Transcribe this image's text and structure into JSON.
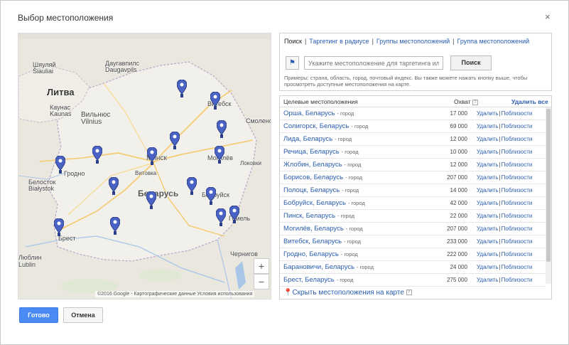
{
  "dialog": {
    "title": "Выбор местоположения",
    "close": "×"
  },
  "map": {
    "labels": {
      "litva": "Литва",
      "belarus": "Беларусь",
      "minsk": "Минск",
      "vitebsk": "Витебск",
      "mogilev": "Могилёв",
      "gomel": "Гомель",
      "grodno": "Гродно",
      "brest": "Брест",
      "bobruysk": "Бобруйск",
      "kaunas": "Каунас\nKaunas",
      "vilnius": "Вильнюс\nVilnius",
      "siauliai": "Шяуляй\nŠiauliai",
      "daugavpils": "Даугавпилс\nDaugavpils",
      "smolensk": "Смоленс",
      "bialystok": "Белосток\nBiałystok",
      "lublin": "Люблин\nLublin",
      "chernigov": "Чернигов",
      "lokovo": "Локовки",
      "vitovka": "Витовка"
    },
    "zoom_in": "+",
    "zoom_out": "−",
    "footer": "©2016 Google - Картографические данные   Условия использования"
  },
  "search": {
    "tabs": [
      "Поиск",
      "Таргетинг в радиусе",
      "Группы местоположений",
      "Группа местоположений"
    ],
    "placeholder": "Укажите местоположение для таргетинга ил",
    "button": "Поиск",
    "hint": "Примеры: страна, область, город, почтовый индекс. Вы также можете нажать кнопку выше, чтобы просмотреть доступные местоположения на карте."
  },
  "results": {
    "col_location": "Целевые местоположения",
    "col_reach": "Охват",
    "remove_all": "Удалить все",
    "remove": "Удалить",
    "nearby": "Поблизости",
    "rows": [
      {
        "name": "Орша, Беларусь",
        "type": "- город",
        "reach": "17 000"
      },
      {
        "name": "Солигорск, Беларусь",
        "type": "- город",
        "reach": "69 000"
      },
      {
        "name": "Лида, Беларусь",
        "type": "- город",
        "reach": "12 000"
      },
      {
        "name": "Речица, Беларусь",
        "type": "- город",
        "reach": "10 000"
      },
      {
        "name": "Жлобин, Беларусь",
        "type": "- город",
        "reach": "12 000"
      },
      {
        "name": "Борисов, Беларусь",
        "type": "- город",
        "reach": "207 000"
      },
      {
        "name": "Полоцк, Беларусь",
        "type": "- город",
        "reach": "14 000"
      },
      {
        "name": "Бобруйск, Беларусь",
        "type": "- город",
        "reach": "42 000"
      },
      {
        "name": "Пинск, Беларусь",
        "type": "- город",
        "reach": "22 000"
      },
      {
        "name": "Могилёв, Беларусь",
        "type": "- город",
        "reach": "207 000"
      },
      {
        "name": "Витебск, Беларусь",
        "type": "- город",
        "reach": "233 000"
      },
      {
        "name": "Гродно, Беларусь",
        "type": "- город",
        "reach": "222 000"
      },
      {
        "name": "Барановичи, Беларусь",
        "type": "- город",
        "reach": "24 000"
      },
      {
        "name": "Брест, Беларусь",
        "type": "- город",
        "reach": "275 000"
      }
    ],
    "hide_map": "Скрыть местоположения на карте"
  },
  "footer": {
    "ok": "Готово",
    "cancel": "Отмена"
  },
  "colors": {
    "accent": "#4a8af4",
    "link": "#2a5db0",
    "pin": "#4b63c4"
  }
}
